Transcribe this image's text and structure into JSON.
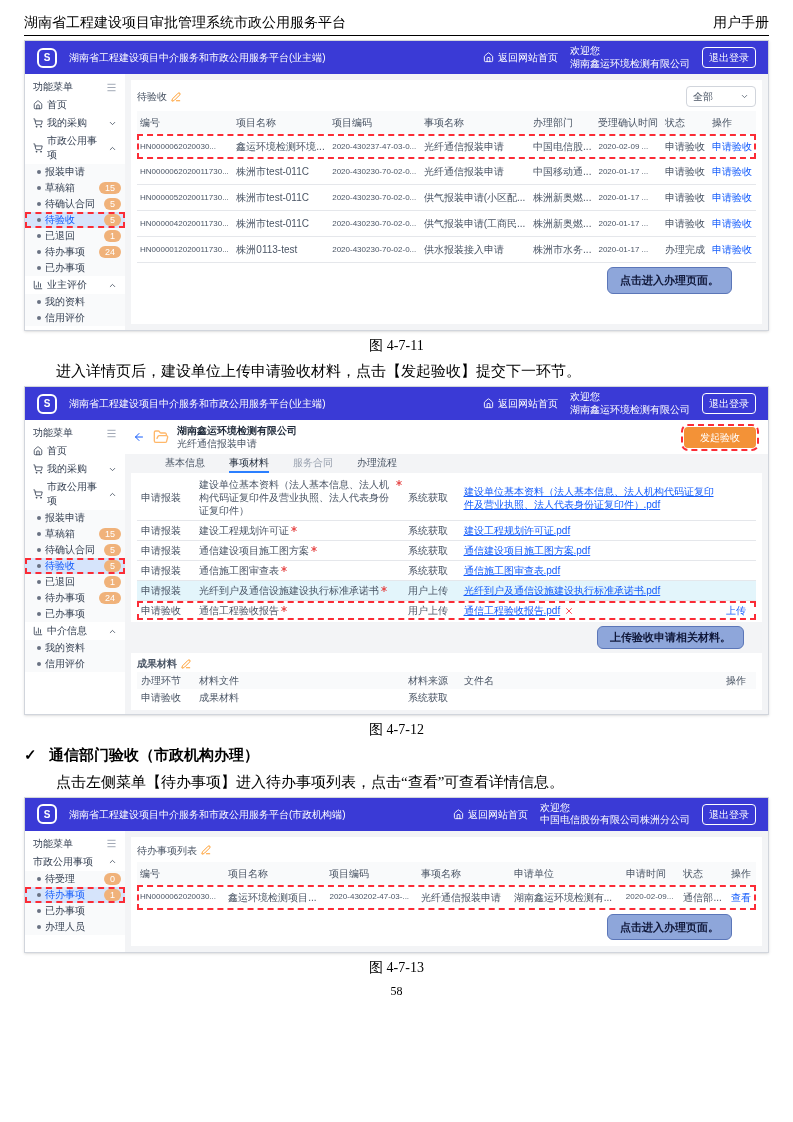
{
  "header": {
    "title": "湖南省工程建设项目审批管理系统市政公用服务平台",
    "manual": "用户手册"
  },
  "figure_1": {
    "screen": {
      "topbar": {
        "logo": "S",
        "title": "湖南省工程建设项目中介服务和市政公用服务平台(业主端)",
        "home_link": "返回网站首页",
        "welcome": "欢迎您",
        "company": "湖南鑫运环境检测有限公司",
        "logout": "退出登录"
      },
      "sidebar": {
        "title": "功能菜单",
        "items": [
          {
            "label": "首页",
            "kind": "home"
          },
          {
            "label": "我的采购",
            "kind": "cart",
            "expanded": false
          },
          {
            "label": "市政公用事项",
            "kind": "cart",
            "expanded": true,
            "children": [
              {
                "label": "报装申请",
                "selected": false,
                "outlined": false
              },
              {
                "label": "草稿箱",
                "count": "15",
                "selected": false,
                "outlined": false
              },
              {
                "label": "待确认合同",
                "count": "5",
                "selected": false,
                "outlined": false
              },
              {
                "label": "待验收",
                "count": "5",
                "selected": true,
                "outlined": true
              },
              {
                "label": "已退回",
                "count": "1",
                "selected": false,
                "outlined": false
              },
              {
                "label": "待办事项",
                "count": "24",
                "selected": false,
                "outlined": false
              },
              {
                "label": "已办事项",
                "selected": false,
                "outlined": false
              }
            ]
          },
          {
            "label": "业主评价",
            "kind": "chart",
            "expanded": true,
            "children": [
              {
                "label": "我的资料",
                "selected": false,
                "outlined": false
              },
              {
                "label": "信用评价",
                "selected": false,
                "outlined": false
              }
            ]
          }
        ]
      },
      "panel": {
        "title": "待验收",
        "filter": "全部",
        "columns": [
          "编号",
          "项目名称",
          "项目编码",
          "事项名称",
          "办理部门",
          "受理确认时间",
          "状态",
          "操作"
        ],
        "rows": [
          {
            "cells": [
              "HN0000062020030...",
              "鑫运环境检测环境...",
              "2020-430237-47-03-0...",
              "光纤通信报装申请",
              "中国电信股...",
              "2020-02-09 ...",
              "申请验收"
            ],
            "action": "申请验收",
            "outlined": true
          },
          {
            "cells": [
              "HN0000062020011730...",
              "株洲市test-011C",
              "2020-430230-70-02-0...",
              "光纤通信报装申请",
              "中国移动通...",
              "2020-01-17 ...",
              "申请验收"
            ],
            "action": "申请验收",
            "outlined": false
          },
          {
            "cells": [
              "HN0000052020011730...",
              "株洲市test-011C",
              "2020-430230-70-02-0...",
              "供气报装申请(小区配...",
              "株洲新奥燃...",
              "2020-01-17 ...",
              "申请验收"
            ],
            "action": "申请验收",
            "outlined": false
          },
          {
            "cells": [
              "HN0000042020011730...",
              "株洲市test-011C",
              "2020-430230-70-02-0...",
              "供气报装申请(工商民...",
              "株洲新奥燃...",
              "2020-01-17 ...",
              "申请验收"
            ],
            "action": "申请验收",
            "outlined": false
          },
          {
            "cells": [
              "HN0000012020011730...",
              "株洲0113-test",
              "2020-430230-70-02-0...",
              "供水报装接入申请",
              "株洲市水务...",
              "2020-01-17 ...",
              "办理完成"
            ],
            "action": "申请验收",
            "outlined": false
          }
        ],
        "callout": "点击进入办理页面。"
      }
    },
    "caption": "图 4-7-11"
  },
  "paragraph_1": "进入详情页后，建设单位上传申请验收材料，点击【发起验收】提交下一环节。",
  "figure_2": {
    "screen": {
      "topbar": {
        "logo": "S",
        "title": "湖南省工程建设项目中介服务和市政公用服务平台(业主端)",
        "home_link": "返回网站首页",
        "welcome": "欢迎您",
        "company": "湖南鑫运环境检测有限公司",
        "logout": "退出登录"
      },
      "sidebar": {
        "title": "功能菜单",
        "items": [
          {
            "label": "首页",
            "kind": "home"
          },
          {
            "label": "我的采购",
            "kind": "cart",
            "expanded": false
          },
          {
            "label": "市政公用事项",
            "kind": "cart",
            "expanded": true,
            "children": [
              {
                "label": "报装申请",
                "selected": false,
                "outlined": false
              },
              {
                "label": "草稿箱",
                "count": "15",
                "selected": false,
                "outlined": false
              },
              {
                "label": "待确认合同",
                "count": "5",
                "selected": false,
                "outlined": false
              },
              {
                "label": "待验收",
                "count": "5",
                "selected": true,
                "outlined": true
              },
              {
                "label": "已退回",
                "count": "1",
                "selected": false,
                "outlined": false
              },
              {
                "label": "待办事项",
                "count": "24",
                "selected": false,
                "outlined": false
              },
              {
                "label": "已办事项",
                "selected": false,
                "outlined": false
              }
            ]
          },
          {
            "label": "中介信息",
            "kind": "chart",
            "expanded": true,
            "children": [
              {
                "label": "我的资料",
                "selected": false,
                "outlined": false
              },
              {
                "label": "信用评价",
                "selected": false,
                "outlined": false
              }
            ]
          }
        ]
      },
      "detail": {
        "company": "湖南鑫运环境检测有限公司",
        "subtitle": "光纤通信报装申请",
        "submit": "发起验收",
        "submit_outlined": true,
        "tabs": [
          {
            "label": "基本信息",
            "selected": false,
            "disabled": false
          },
          {
            "label": "事项材料",
            "selected": true,
            "disabled": false
          },
          {
            "label": "服务合同",
            "selected": false,
            "disabled": true
          },
          {
            "label": "办理流程",
            "selected": false,
            "disabled": false
          }
        ],
        "materials": [
          {
            "stage": "申请报装",
            "material": "建设单位基本资料（法人基本信息、法人机构代码证复印件及营业执照、法人代表身份证复印件）",
            "required": true,
            "source": "系统获取",
            "file": "建设单位基本资料（法人基本信息、法人机构代码证复印件及营业执照、法人代表身份证复印件）.pdf",
            "removable": false,
            "hovered": false,
            "outlined": false
          },
          {
            "stage": "申请报装",
            "material": "建设工程规划许可证",
            "required": true,
            "source": "系统获取",
            "file": "建设工程规划许可证.pdf",
            "removable": false,
            "hovered": false,
            "outlined": false
          },
          {
            "stage": "申请报装",
            "material": "通信建设项目施工图方案",
            "required": true,
            "source": "系统获取",
            "file": "通信建设项目施工图方案.pdf",
            "removable": false,
            "hovered": false,
            "outlined": false
          },
          {
            "stage": "申请报装",
            "material": "通信施工图审查表",
            "required": true,
            "source": "系统获取",
            "file": "通信施工图审查表.pdf",
            "removable": false,
            "hovered": false,
            "outlined": false
          },
          {
            "stage": "申请报装",
            "material": "光纤到户及通信设施建设执行标准承诺书",
            "required": true,
            "source": "用户上传",
            "file": "光纤到户及通信设施建设执行标准承诺书.pdf",
            "removable": false,
            "hovered": true,
            "outlined": false
          },
          {
            "stage": "申请验收",
            "material": "通信工程验收报告",
            "required": true,
            "source": "用户上传",
            "file": "通信工程验收报告.pdf",
            "removable": true,
            "action": "上传",
            "hovered": false,
            "outlined": true
          }
        ],
        "callout": "上传验收申请相关材料。",
        "results": {
          "title": "成果材料",
          "columns": [
            "办理环节",
            "材料文件",
            "材料来源",
            "文件名",
            "操作"
          ],
          "rows": [
            [
              "申请验收",
              "成果材料",
              "系统获取"
            ]
          ]
        }
      }
    },
    "caption": "图 4-7-12"
  },
  "section_heading": {
    "marker": "✓",
    "text": "通信部门验收（市政机构办理）"
  },
  "paragraph_2": "点击左侧菜单【待办事项】进入待办事项列表，点击“查看”可查看详情信息。",
  "figure_3": {
    "screen": {
      "topbar": {
        "logo": "S",
        "title": "湖南省工程建设项目中介服务和市政公用服务平台(市政机构端)",
        "home_link": "返回网站首页",
        "welcome": "欢迎您",
        "company": "中国电信股份有限公司株洲分公司",
        "logout": "退出登录"
      },
      "sidebar": {
        "title": "功能菜单",
        "items": [
          {
            "label": "市政公用事项",
            "expanded": true,
            "children": [
              {
                "label": "待受理",
                "count": "0",
                "selected": false,
                "outlined": false
              },
              {
                "label": "待办事项",
                "count": "1",
                "selected": true,
                "outlined": true
              },
              {
                "label": "已办事项",
                "selected": false,
                "outlined": false
              },
              {
                "label": "办理人员",
                "selected": false,
                "outlined": false
              }
            ]
          }
        ]
      },
      "panel": {
        "title": "待办事项列表",
        "columns": [
          "编号",
          "项目名称",
          "项目编码",
          "事项名称",
          "申请单位",
          "申请时间",
          "状态",
          "操作"
        ],
        "rows": [
          {
            "cells": [
              "HN0000062020030...",
              "鑫运环境检测项目...",
              "2020-430202-47-03-...",
              "光纤通信报装申请",
              "湖南鑫运环境检测有...",
              "2020-02-09...",
              "通信部..."
            ],
            "action": "查看",
            "outlined": true
          }
        ],
        "callout": "点击进入办理页面。"
      }
    },
    "caption": "图 4-7-13"
  },
  "page_number": "58"
}
